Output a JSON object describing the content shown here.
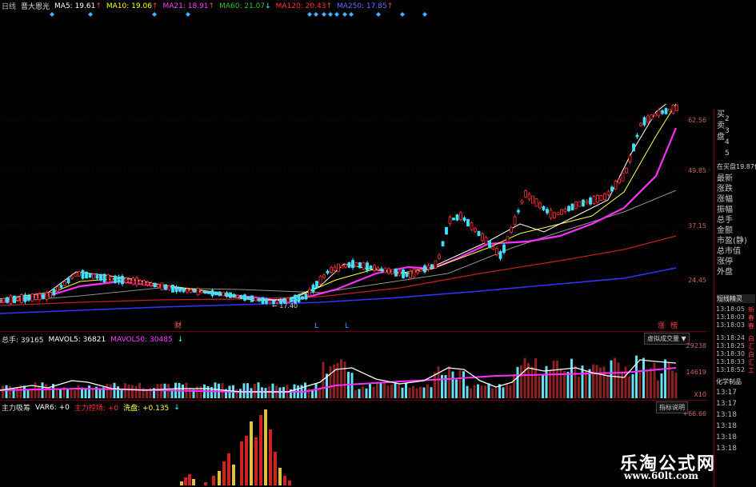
{
  "header": {
    "period": "日线",
    "stock_name": "晋大恩光",
    "ma": [
      {
        "label": "MA5: 19.61",
        "arrow": "↑",
        "color": "#ffffff"
      },
      {
        "label": "MA10: 19.06",
        "arrow": "↑",
        "color": "#ffff00"
      },
      {
        "label": "MA21: 18.91",
        "arrow": "↑",
        "color": "#ff00ff"
      },
      {
        "label": "MA60: 21.07",
        "arrow": "↓",
        "color": "#00c000"
      },
      {
        "label": "MA120: 20.43",
        "arrow": "↑",
        "color": "#ff3030"
      },
      {
        "label": "MA250: 17.85",
        "arrow": "↑",
        "color": "#6060ff"
      }
    ],
    "signal_diamond": "◆"
  },
  "price_axis": [
    "62.56",
    "49.85",
    "37.15",
    "24.45"
  ],
  "price_markers": {
    "low_label": "← 17.40",
    "events": [
      "财",
      "L",
      "L"
    ],
    "event_right_1": "涨",
    "event_right_2": "榜"
  },
  "volume_panel": {
    "total": "总手: 39165",
    "mavol5": "MAVOL5: 36821",
    "mavol50": "MAVOL50: 30485",
    "arrow": "↓",
    "dropdown": "虚拟成交量 ▼",
    "axis": [
      "29238",
      "14619",
      "X10"
    ]
  },
  "indicator_panel": {
    "title": "主力吸筹",
    "var6": "VAR6: +0",
    "main_ctrl": "主力控场: +0",
    "wash": "洗盘: +0.135",
    "arrow": "↓",
    "button": "指标说明",
    "axis_top": "+66.66"
  },
  "right_panel": {
    "book": [
      "买",
      "卖",
      "盘"
    ],
    "numbers": [
      "2",
      "3",
      "4",
      "5"
    ],
    "in_buy": "在买盘19.87位",
    "fields": [
      "最新",
      "涨跌",
      "涨幅",
      "振幅",
      "总手",
      "金额",
      "市盈(静)",
      "总市值",
      "涨停",
      "外盘"
    ],
    "tab": "短线精灵",
    "times": [
      "13:18:05",
      "13:18:03",
      "13:18:03",
      "13:18:24",
      "13:18:25",
      "13:18:30",
      "13:18:33",
      "13:18:52"
    ],
    "tags": [
      "新",
      "春",
      "春",
      "白",
      "汇",
      "白",
      "汇",
      "工"
    ],
    "sector": "化学制品",
    "times2": [
      "13:17",
      "13:17",
      "13:18",
      "13:18",
      "13:18",
      "13:18"
    ]
  },
  "watermark": {
    "name": "乐淘公式网",
    "url": "www.60lt.com"
  },
  "chart_data": {
    "type": "candlestick",
    "title": "晋大恩光",
    "price_ticks": [
      24.45,
      37.15,
      49.85,
      62.56
    ],
    "note": "price visually ~17 to ~65 across ~200 daily bars; volume bars and MAVOL lines below",
    "volume_ticks": [
      14619,
      29238
    ]
  }
}
